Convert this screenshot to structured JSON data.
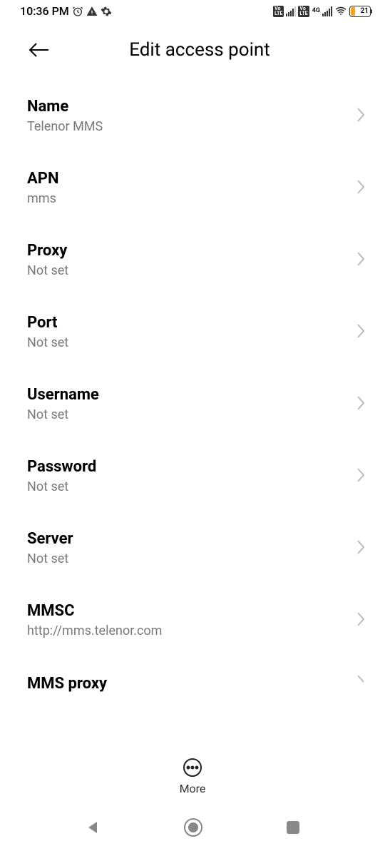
{
  "statusBar": {
    "time": "10:36 PM",
    "batteryPercent": "21"
  },
  "header": {
    "title": "Edit access point"
  },
  "settings": [
    {
      "label": "Name",
      "value": "Telenor MMS"
    },
    {
      "label": "APN",
      "value": "mms"
    },
    {
      "label": "Proxy",
      "value": "Not set"
    },
    {
      "label": "Port",
      "value": "Not set"
    },
    {
      "label": "Username",
      "value": "Not set"
    },
    {
      "label": "Password",
      "value": "Not set"
    },
    {
      "label": "Server",
      "value": "Not set"
    },
    {
      "label": "MMSC",
      "value": "http://mms.telenor.com"
    },
    {
      "label": "MMS proxy",
      "value": ""
    }
  ],
  "more": {
    "label": "More"
  }
}
